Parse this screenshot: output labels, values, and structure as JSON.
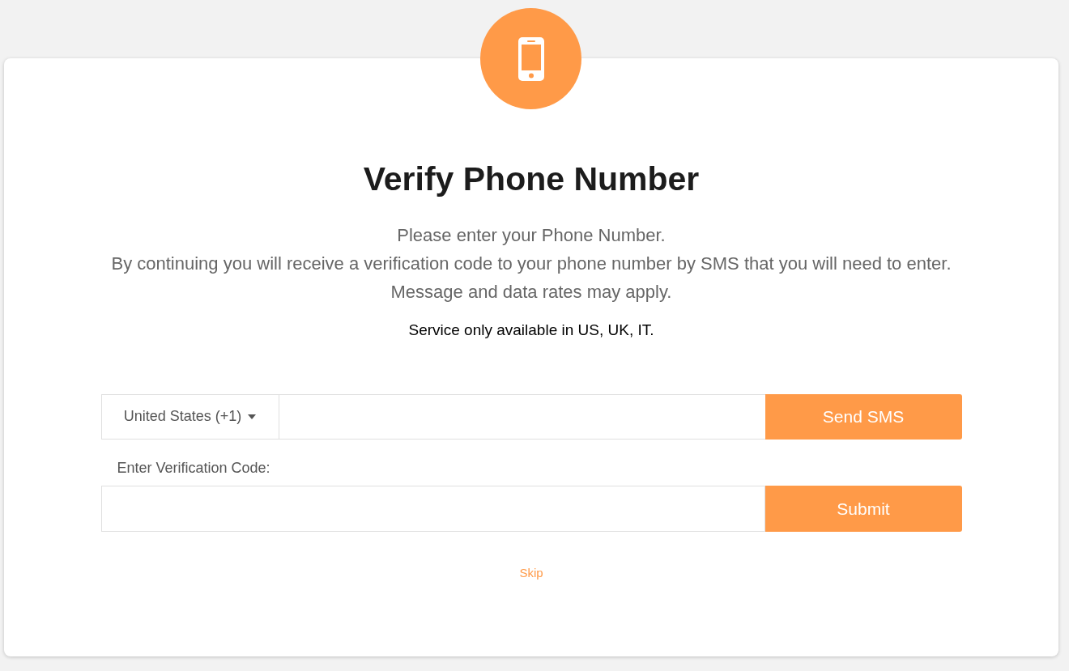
{
  "title": "Verify Phone Number",
  "description": [
    "Please enter your Phone Number.",
    "By continuing you will receive a verification code to your phone number by SMS that you will need to enter.",
    "Message and data rates may apply."
  ],
  "notice": "Service only available in US, UK, IT.",
  "country_select": {
    "value": "United States (+1)"
  },
  "send_button": "Send SMS",
  "code_label": "Enter Verification Code:",
  "submit_button": "Submit",
  "skip_link": "Skip"
}
